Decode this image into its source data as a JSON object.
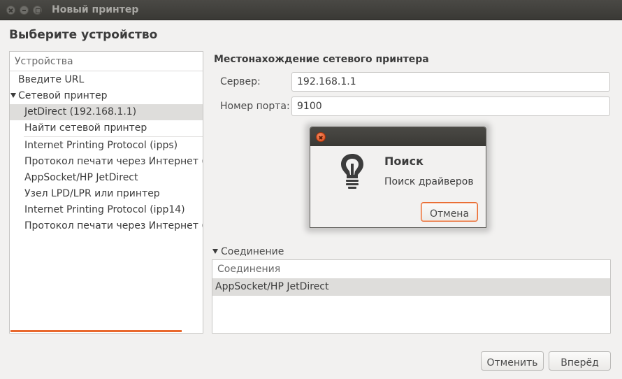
{
  "window": {
    "title": "Новый принтер"
  },
  "page": {
    "heading": "Выберите устройство"
  },
  "devices": {
    "header": "Устройства",
    "items": [
      {
        "label": "Введите URL"
      },
      {
        "label": "Сетевой принтер"
      },
      {
        "label": "JetDirect (192.168.1.1)"
      },
      {
        "label": "Найти сетевой принтер"
      },
      {
        "label": "Internet Printing Protocol (ipps)"
      },
      {
        "label": "Протокол печати через Интернет (ip"
      },
      {
        "label": "AppSocket/HP JetDirect"
      },
      {
        "label": "Узел LPD/LPR или принтер"
      },
      {
        "label": "Internet Printing Protocol (ipp14)"
      },
      {
        "label": "Протокол печати через Интернет (ht"
      }
    ]
  },
  "location": {
    "title": "Местонахождение сетевого принтера",
    "server_label": "Сервер:",
    "server_value": "192.168.1.1",
    "port_label": "Номер порта:",
    "port_value": "9100"
  },
  "connection": {
    "expander_label": "Соединение",
    "header": "Соединения",
    "rows": [
      "AppSocket/HP JetDirect"
    ]
  },
  "buttons": {
    "cancel": "Отменить",
    "forward": "Вперёд"
  },
  "dialog": {
    "heading": "Поиск",
    "text": "Поиск драйверов",
    "cancel": "Отмена"
  },
  "colors": {
    "accent": "#e9682d",
    "titlebar": "#3c3b37",
    "selection": "#dedddb"
  }
}
